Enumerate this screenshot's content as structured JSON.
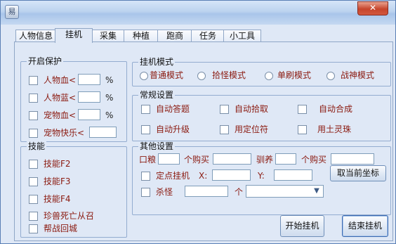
{
  "window": {
    "app_icon": "易",
    "close_label": "✕"
  },
  "tabs": [
    {
      "label": "人物信息"
    },
    {
      "label": "挂机"
    },
    {
      "label": "采集"
    },
    {
      "label": "种植"
    },
    {
      "label": "跑商"
    },
    {
      "label": "任务"
    },
    {
      "label": "小工具"
    }
  ],
  "active_tab": "挂机",
  "protect": {
    "title": "开启保护",
    "items": [
      {
        "label": "人物血<",
        "value": "",
        "suffix": "%"
      },
      {
        "label": "人物蓝<",
        "value": "",
        "suffix": "%"
      },
      {
        "label": "宠物血<",
        "value": "",
        "suffix": "%"
      },
      {
        "label": "宠物快乐<",
        "value": ""
      }
    ]
  },
  "skills": {
    "title": "技能",
    "items": [
      {
        "label": "技能F2"
      },
      {
        "label": "技能F3"
      },
      {
        "label": "技能F4"
      },
      {
        "label": "珍兽死亡从召"
      },
      {
        "label": "帮战回城"
      }
    ]
  },
  "mode": {
    "title": "挂机模式",
    "options": [
      {
        "label": "普通模式"
      },
      {
        "label": "拾怪模式"
      },
      {
        "label": "单刷模式"
      },
      {
        "label": "战神模式"
      }
    ]
  },
  "general": {
    "title": "常规设置",
    "items": [
      {
        "label": "自动答题"
      },
      {
        "label": "自动拾取"
      },
      {
        "label": "自动合成"
      },
      {
        "label": "自动升级"
      },
      {
        "label": "用定位符"
      },
      {
        "label": "用土灵珠"
      }
    ]
  },
  "other": {
    "title": "其他设置",
    "ration_label": "口粮",
    "buy_label_1": "个购买",
    "tame_label": "驯养",
    "buy_label_2": "个购买",
    "fixed_label": "定点挂机",
    "x_label": "X:",
    "y_label": "Y:",
    "cancel_coords_label": "取当前坐标",
    "kill_label": "杀怪",
    "count_label": "个",
    "select_value": ""
  },
  "buttons": {
    "start": "开始挂机",
    "end": "结束挂机"
  },
  "icons": {
    "app": "app-icon",
    "close": "close-icon",
    "dropdown": "chevron-down-icon"
  }
}
